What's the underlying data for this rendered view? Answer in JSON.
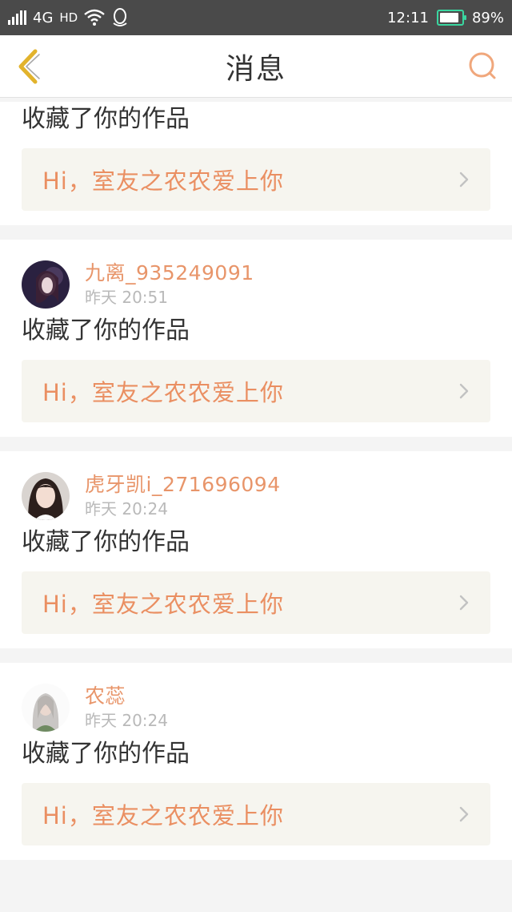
{
  "status_bar": {
    "network": "4G",
    "hd": "HD",
    "time": "12:11",
    "battery": "89%",
    "battery_level": 0.89
  },
  "header": {
    "title": "消息"
  },
  "feed": [
    {
      "action": "收藏了你的作品",
      "work_title": "Hi，室友之农农爱上你"
    },
    {
      "username": "九离_935249091",
      "time": "昨天 20:51",
      "action": "收藏了你的作品",
      "work_title": "Hi，室友之农农爱上你"
    },
    {
      "username": "虎牙凯i_271696094",
      "time": "昨天 20:24",
      "action": "收藏了你的作品",
      "work_title": "Hi，室友之农农爱上你"
    },
    {
      "username": "农蕊",
      "time": "昨天 20:24",
      "action": "收藏了你的作品",
      "work_title": "Hi，室友之农农爱上你"
    }
  ],
  "colors": {
    "accent": "#e8956a",
    "nav_back": "#e2b32c"
  }
}
